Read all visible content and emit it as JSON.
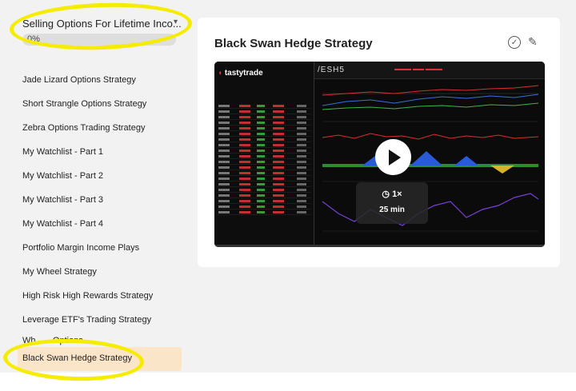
{
  "sidebar": {
    "course_title": "Selling Options For Lifetime Inco...",
    "progress": 0.0,
    "progress_label": "0%",
    "lessons": [
      {
        "label": "Jade Lizard Options Strategy"
      },
      {
        "label": "Short Strangle Options Strategy"
      },
      {
        "label": "Zebra Options Trading Strategy"
      },
      {
        "label": "My Watchlist - Part 1"
      },
      {
        "label": "My Watchlist - Part 2"
      },
      {
        "label": "My Watchlist - Part 3"
      },
      {
        "label": "My Watchlist - Part 4"
      },
      {
        "label": "Portfolio Margin Income Plays"
      },
      {
        "label": "My Wheel Strategy"
      },
      {
        "label": "High Risk High Rewards Strategy"
      },
      {
        "label": "Leverage ETF's Trading Strategy"
      },
      {
        "label": "Wh... ...Options -"
      },
      {
        "label": "Black Swan Hedge Strategy"
      }
    ],
    "active_index": 12
  },
  "main": {
    "heading": "Black Swan Hedge Strategy",
    "check_icon": "check-circle-icon",
    "edit_icon": "pencil-icon"
  },
  "video": {
    "brand": "tastytrade",
    "ticker": "/ESH5",
    "speed": "1×",
    "duration": "25 min",
    "play_icon": "play-icon"
  },
  "colors": {
    "highlight": "#f5ec00",
    "active_lesson_bg": "#fbe5c8",
    "brand_red": "#e0312b"
  }
}
